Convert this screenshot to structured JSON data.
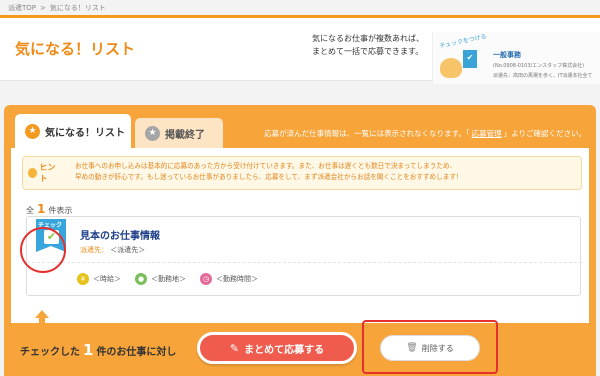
{
  "breadcrumb": {
    "home": "派遣TOP",
    "separator": ">",
    "current": "気になる！リスト"
  },
  "hero": {
    "title": "気になる！リスト",
    "desc_line1": "気になるお仕事が複数あれば、",
    "desc_line2": "まとめて一括で応募できます。",
    "sample": {
      "tag": "チェックをつける",
      "check_label": "チェック",
      "line1": "一般事務",
      "line2": "(No.0908-0103/エンスタッフ株式会社)",
      "line3": "派遣先：高田の馬場を歩く、IT派遣本社全て"
    }
  },
  "tabs": [
    {
      "label": "気になる！リスト",
      "icon": "star-icon",
      "active": true
    },
    {
      "label": "掲載終了",
      "icon": "star-icon",
      "active": false
    }
  ],
  "notice": {
    "text_before": "応募が済んだ仕事情報は、一覧には表示されなくなります。「",
    "link": "応募管理",
    "text_after": "」よりご確認ください。"
  },
  "hint": {
    "label": "ヒント",
    "line1": "お仕事へのお申し込みは基本的に応募のあった方から受け付けていきます。また、お仕事は遅くとも数日で決まってしまうため、",
    "line2": "早めの動きが肝心です。もし迷っているお仕事がありましたら、応募をして、まず派遣会社からお話を聞くことをおすすめします！"
  },
  "count": {
    "prefix": "全",
    "value": "1",
    "suffix": "件表示"
  },
  "jobs": [
    {
      "ribbon_label": "チェック",
      "check_mark": "✔",
      "title": "見本のお仕事情報",
      "dest_label": "派遣先：",
      "dest_value": "＜派遣先＞",
      "wage": "＜時給＞",
      "location": "＜勤務地＞",
      "hours": "＜勤務時間＞",
      "checked": true
    }
  ],
  "bottom": {
    "text_before": "チェックした",
    "count": "1",
    "text_after": "件のお仕事に対し",
    "apply_label": "まとめて応募する",
    "delete_label": "削除する"
  },
  "colors": {
    "accent_orange": "#f7a53b",
    "title_orange": "#ef8a16",
    "apply_red": "#ef5b4d",
    "ribbon_blue": "#37a6dd",
    "annotation_red": "#e3312e"
  }
}
